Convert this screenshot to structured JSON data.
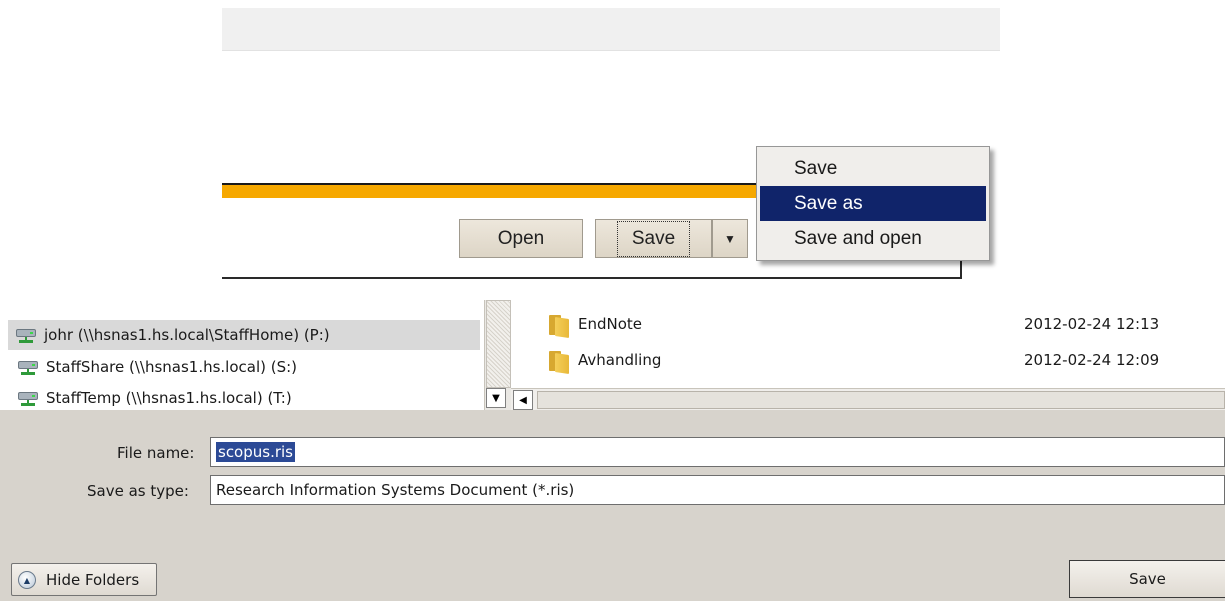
{
  "download_bar": {
    "open_label": "Open",
    "save_label": "Save",
    "dropdown_arrow": "▼",
    "accent_color": "#f6a800"
  },
  "context_menu": {
    "items": [
      {
        "label": "Save",
        "highlighted": false
      },
      {
        "label": "Save as",
        "highlighted": true
      },
      {
        "label": "Save and open",
        "highlighted": false
      }
    ],
    "highlight_color": "#10246a"
  },
  "dialog": {
    "nav_items": [
      {
        "label": "johr (\\\\hsnas1.hs.local\\StaffHome) (P:)",
        "icon": "network-drive-icon",
        "selected": true
      },
      {
        "label": "StaffShare (\\\\hsnas1.hs.local) (S:)",
        "icon": "network-drive-icon",
        "selected": false
      },
      {
        "label": "StaffTemp (\\\\hsnas1.hs.local) (T:)",
        "icon": "network-drive-icon",
        "selected": false
      }
    ],
    "files": [
      {
        "name": "EndNote",
        "date": "2012-02-24 12:13",
        "type": "File",
        "icon": "folder-icon"
      },
      {
        "name": "Avhandling",
        "date": "2012-02-24 12:09",
        "type": "File",
        "icon": "folder-icon"
      }
    ],
    "file_name_label": "File name:",
    "file_name_value": "scopus.ris",
    "save_as_type_label": "Save as type:",
    "save_as_type_value": "Research Information Systems Document (*.ris)",
    "hide_folders_label": "Hide Folders",
    "save_button_label": "Save",
    "scroll_arrows": {
      "down": "▼",
      "left": "◀"
    }
  }
}
